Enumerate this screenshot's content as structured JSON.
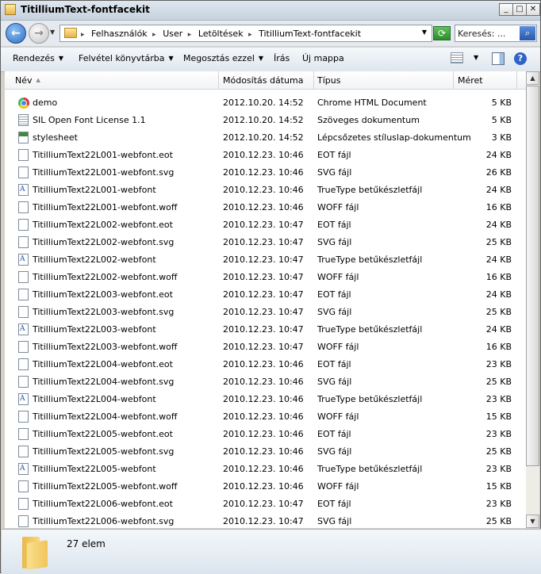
{
  "window": {
    "title": "TitilliumText-fontfacekit"
  },
  "address": {
    "crumbs": [
      "Felhasználók",
      "User",
      "Letöltések",
      "TitilliumText-fontfacekit"
    ],
    "search_placeholder": "Keresés: ..."
  },
  "commands": {
    "organize": "Rendezés",
    "include_library": "Felvétel könyvtárba",
    "share": "Megosztás ezzel",
    "burn": "Írás",
    "new_folder": "Új mappa"
  },
  "columns": {
    "name": "Név",
    "date": "Módosítás dátuma",
    "type": "Típus",
    "size": "Méret"
  },
  "files": [
    {
      "icon": "chrome-html-icon",
      "name": "demo",
      "date": "2012.10.20. 14:52",
      "type": "Chrome HTML Document",
      "size": "5 KB"
    },
    {
      "icon": "text-file-icon",
      "name": "SIL Open Font License 1.1",
      "date": "2012.10.20. 14:52",
      "type": "Szöveges dokumentum",
      "size": "5 KB"
    },
    {
      "icon": "css-file-icon",
      "name": "stylesheet",
      "date": "2012.10.20. 14:52",
      "type": "Lépcsőzetes stíluslap-dokumentum",
      "size": "3 KB"
    },
    {
      "icon": "file-icon",
      "name": "TitilliumText22L001-webfont.eot",
      "date": "2010.12.23. 10:46",
      "type": "EOT fájl",
      "size": "24 KB"
    },
    {
      "icon": "file-icon",
      "name": "TitilliumText22L001-webfont.svg",
      "date": "2010.12.23. 10:46",
      "type": "SVG fájl",
      "size": "26 KB"
    },
    {
      "icon": "font-file-icon",
      "name": "TitilliumText22L001-webfont",
      "date": "2010.12.23. 10:46",
      "type": "TrueType betűkészletfájl",
      "size": "24 KB"
    },
    {
      "icon": "file-icon",
      "name": "TitilliumText22L001-webfont.woff",
      "date": "2010.12.23. 10:46",
      "type": "WOFF fájl",
      "size": "16 KB"
    },
    {
      "icon": "file-icon",
      "name": "TitilliumText22L002-webfont.eot",
      "date": "2010.12.23. 10:47",
      "type": "EOT fájl",
      "size": "24 KB"
    },
    {
      "icon": "file-icon",
      "name": "TitilliumText22L002-webfont.svg",
      "date": "2010.12.23. 10:47",
      "type": "SVG fájl",
      "size": "25 KB"
    },
    {
      "icon": "font-file-icon",
      "name": "TitilliumText22L002-webfont",
      "date": "2010.12.23. 10:47",
      "type": "TrueType betűkészletfájl",
      "size": "24 KB"
    },
    {
      "icon": "file-icon",
      "name": "TitilliumText22L002-webfont.woff",
      "date": "2010.12.23. 10:47",
      "type": "WOFF fájl",
      "size": "16 KB"
    },
    {
      "icon": "file-icon",
      "name": "TitilliumText22L003-webfont.eot",
      "date": "2010.12.23. 10:47",
      "type": "EOT fájl",
      "size": "24 KB"
    },
    {
      "icon": "file-icon",
      "name": "TitilliumText22L003-webfont.svg",
      "date": "2010.12.23. 10:47",
      "type": "SVG fájl",
      "size": "25 KB"
    },
    {
      "icon": "font-file-icon",
      "name": "TitilliumText22L003-webfont",
      "date": "2010.12.23. 10:47",
      "type": "TrueType betűkészletfájl",
      "size": "24 KB"
    },
    {
      "icon": "file-icon",
      "name": "TitilliumText22L003-webfont.woff",
      "date": "2010.12.23. 10:47",
      "type": "WOFF fájl",
      "size": "16 KB"
    },
    {
      "icon": "file-icon",
      "name": "TitilliumText22L004-webfont.eot",
      "date": "2010.12.23. 10:46",
      "type": "EOT fájl",
      "size": "23 KB"
    },
    {
      "icon": "file-icon",
      "name": "TitilliumText22L004-webfont.svg",
      "date": "2010.12.23. 10:46",
      "type": "SVG fájl",
      "size": "25 KB"
    },
    {
      "icon": "font-file-icon",
      "name": "TitilliumText22L004-webfont",
      "date": "2010.12.23. 10:46",
      "type": "TrueType betűkészletfájl",
      "size": "23 KB"
    },
    {
      "icon": "file-icon",
      "name": "TitilliumText22L004-webfont.woff",
      "date": "2010.12.23. 10:46",
      "type": "WOFF fájl",
      "size": "15 KB"
    },
    {
      "icon": "file-icon",
      "name": "TitilliumText22L005-webfont.eot",
      "date": "2010.12.23. 10:46",
      "type": "EOT fájl",
      "size": "23 KB"
    },
    {
      "icon": "file-icon",
      "name": "TitilliumText22L005-webfont.svg",
      "date": "2010.12.23. 10:46",
      "type": "SVG fájl",
      "size": "25 KB"
    },
    {
      "icon": "font-file-icon",
      "name": "TitilliumText22L005-webfont",
      "date": "2010.12.23. 10:46",
      "type": "TrueType betűkészletfájl",
      "size": "23 KB"
    },
    {
      "icon": "file-icon",
      "name": "TitilliumText22L005-webfont.woff",
      "date": "2010.12.23. 10:46",
      "type": "WOFF fájl",
      "size": "15 KB"
    },
    {
      "icon": "file-icon",
      "name": "TitilliumText22L006-webfont.eot",
      "date": "2010.12.23. 10:47",
      "type": "EOT fájl",
      "size": "23 KB"
    },
    {
      "icon": "file-icon",
      "name": "TitilliumText22L006-webfont.svg",
      "date": "2010.12.23. 10:47",
      "type": "SVG fájl",
      "size": "25 KB"
    }
  ],
  "status": {
    "item_count": "27 elem"
  }
}
